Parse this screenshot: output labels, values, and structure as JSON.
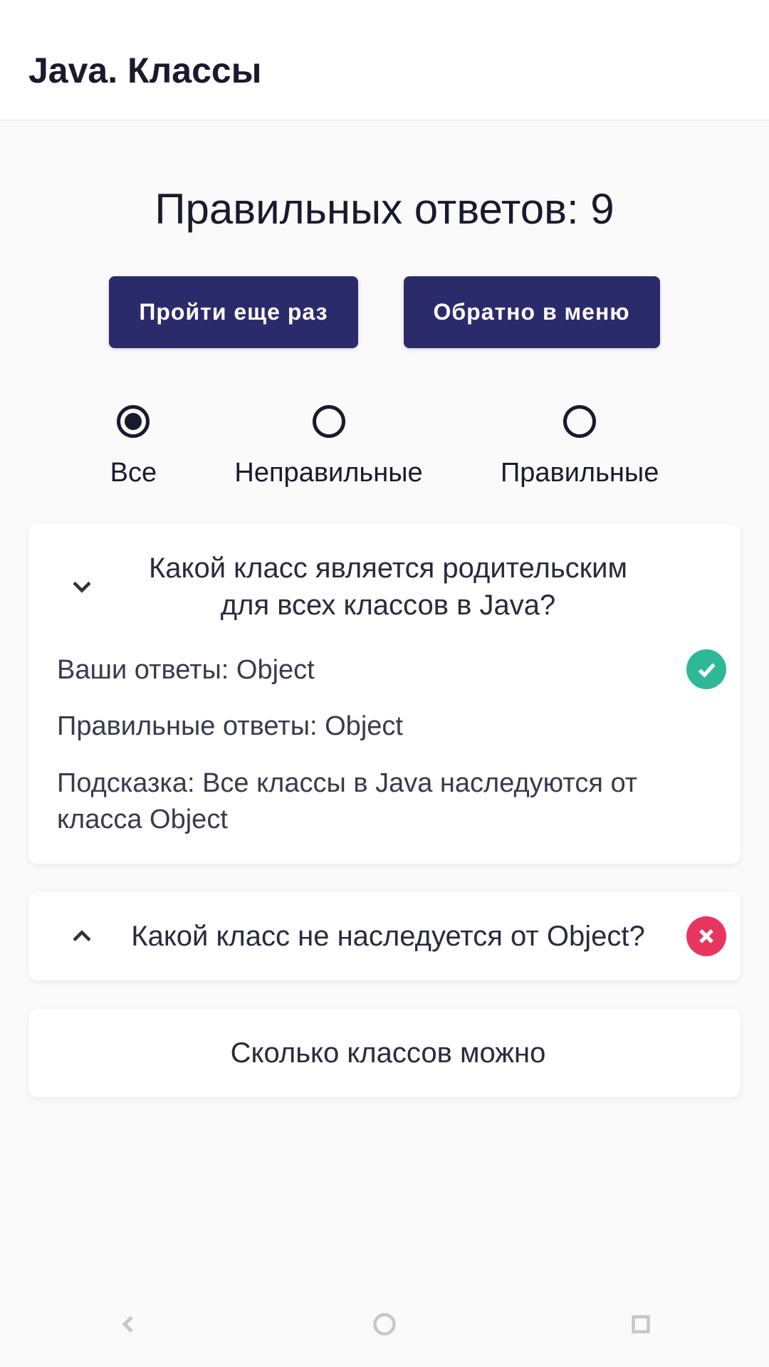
{
  "header": {
    "title": "Java. Классы"
  },
  "score": {
    "label": "Правильных ответов: 9"
  },
  "buttons": {
    "retry": "Пройти еще раз",
    "back": "Обратно в меню"
  },
  "filters": {
    "all": "Все",
    "incorrect": "Неправильные",
    "correct": "Правильные"
  },
  "questions": [
    {
      "text": "Какой класс является родительским для всех классов в Java?",
      "expanded": true,
      "status": "correct",
      "your_answer": "Ваши ответы: Object",
      "correct_answer": "Правильные ответы: Object",
      "hint": "Подсказка: Все классы в Java наследуются от класса Object"
    },
    {
      "text": "Какой класс не наследуется от Object?",
      "expanded": false,
      "status": "incorrect"
    },
    {
      "text": "Сколько классов можно",
      "expanded": false,
      "status": "correct"
    }
  ]
}
